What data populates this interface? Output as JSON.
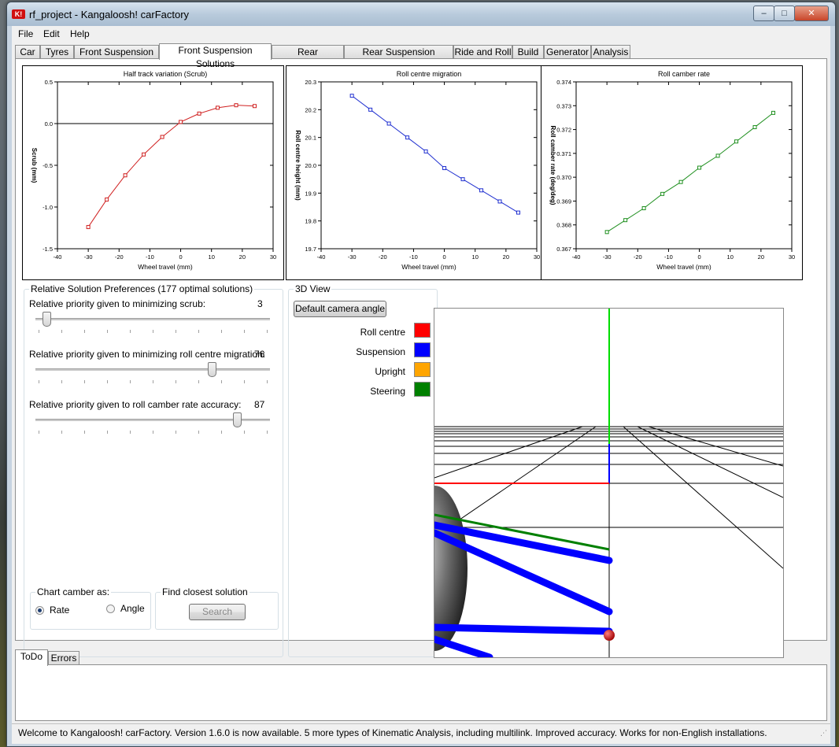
{
  "window": {
    "title": "rf_project - Kangaloosh! carFactory",
    "app_icon": "K!",
    "minimize": "–",
    "maximize": "□",
    "close": "✕"
  },
  "menu": [
    "File",
    "Edit",
    "Help"
  ],
  "tabs": [
    "Car",
    "Tyres",
    "Front Suspension",
    "Front Suspension Solutions",
    "Rear Suspension",
    "Rear Suspension Solutions",
    "Ride and Roll",
    "Build",
    "Generator",
    "Analysis"
  ],
  "active_tab": "Front Suspension Solutions",
  "chart_data": [
    {
      "type": "line",
      "title": "Half track variation (Scrub)",
      "xlabel": "Wheel travel (mm)",
      "ylabel": "Scrub (mm)",
      "color": "#d02020",
      "xlim": [
        -40,
        30
      ],
      "ylim": [
        -1.5,
        0.5
      ],
      "xticks": [
        "-40",
        "-30",
        "-20",
        "-10",
        "0",
        "10",
        "20",
        "30"
      ],
      "yticks": [
        "-1.5",
        "-1.0",
        "-0.5",
        "0.0",
        "0.5"
      ],
      "x": [
        -30,
        -24,
        -18,
        -12,
        -6,
        0,
        6,
        12,
        18,
        24
      ],
      "y": [
        -1.24,
        -0.91,
        -0.62,
        -0.37,
        -0.16,
        0.02,
        0.12,
        0.19,
        0.22,
        0.21
      ],
      "zero_line": true
    },
    {
      "type": "line",
      "title": "Roll centre migration",
      "xlabel": "Wheel travel (mm)",
      "ylabel": "Roll centre height (mm)",
      "color": "#2030d0",
      "xlim": [
        -40,
        30
      ],
      "ylim": [
        19.7,
        20.3
      ],
      "xticks": [
        "-40",
        "-30",
        "-20",
        "-10",
        "0",
        "10",
        "20",
        "30"
      ],
      "yticks": [
        "19.7",
        "19.8",
        "19.9",
        "20.0",
        "20.1",
        "20.2",
        "20.3"
      ],
      "x": [
        -30,
        -24,
        -18,
        -12,
        -6,
        0,
        6,
        12,
        18,
        24
      ],
      "y": [
        20.25,
        20.2,
        20.15,
        20.1,
        20.05,
        19.99,
        19.95,
        19.91,
        19.87,
        19.83
      ]
    },
    {
      "type": "line",
      "title": "Roll camber rate",
      "xlabel": "Wheel travel (mm)",
      "ylabel": "Roll camber rate (deg/deg)",
      "color": "#209020",
      "xlim": [
        -40,
        30
      ],
      "ylim": [
        0.367,
        0.374
      ],
      "xticks": [
        "-40",
        "-30",
        "-20",
        "-10",
        "0",
        "10",
        "20",
        "30"
      ],
      "yticks": [
        "0.367",
        "0.368",
        "0.369",
        "0.370",
        "0.371",
        "0.372",
        "0.373",
        "0.374"
      ],
      "x": [
        -30,
        -24,
        -18,
        -12,
        -6,
        0,
        6,
        12,
        18,
        24
      ],
      "y": [
        0.3677,
        0.3682,
        0.3687,
        0.3693,
        0.3698,
        0.3704,
        0.3709,
        0.3715,
        0.3721,
        0.3727
      ]
    }
  ],
  "preferences": {
    "title": "Relative Solution Preferences (177 optimal solutions)",
    "sliders": [
      {
        "label": "Relative priority given to minimizing scrub:",
        "value": "3",
        "fraction": 0.03
      },
      {
        "label": "Relative priority given to minimizing roll centre migration:",
        "value": "76",
        "fraction": 0.76
      },
      {
        "label": "Relative priority given to roll camber rate accuracy:",
        "value": "87",
        "fraction": 0.87
      }
    ],
    "camber_group": {
      "title": "Chart camber as:",
      "options": [
        "Rate",
        "Angle"
      ],
      "selected": "Rate"
    },
    "closest_group": {
      "title": "Find closest solution",
      "button": "Search"
    }
  },
  "view3d": {
    "title": "3D View",
    "camera_button": "Default camera angle",
    "legend": [
      {
        "label": "Roll centre",
        "color": "#ff0000"
      },
      {
        "label": "Suspension",
        "color": "#0000ff"
      },
      {
        "label": "Upright",
        "color": "#ffa500"
      },
      {
        "label": "Steering",
        "color": "#008000"
      }
    ]
  },
  "bottom_tabs": [
    "ToDo",
    "Errors"
  ],
  "status": "Welcome to Kangaloosh! carFactory.  Version 1.6.0 is now available. 5 more types of Kinematic Analysis, including multilink. Improved accuracy. Works for non-English installations."
}
